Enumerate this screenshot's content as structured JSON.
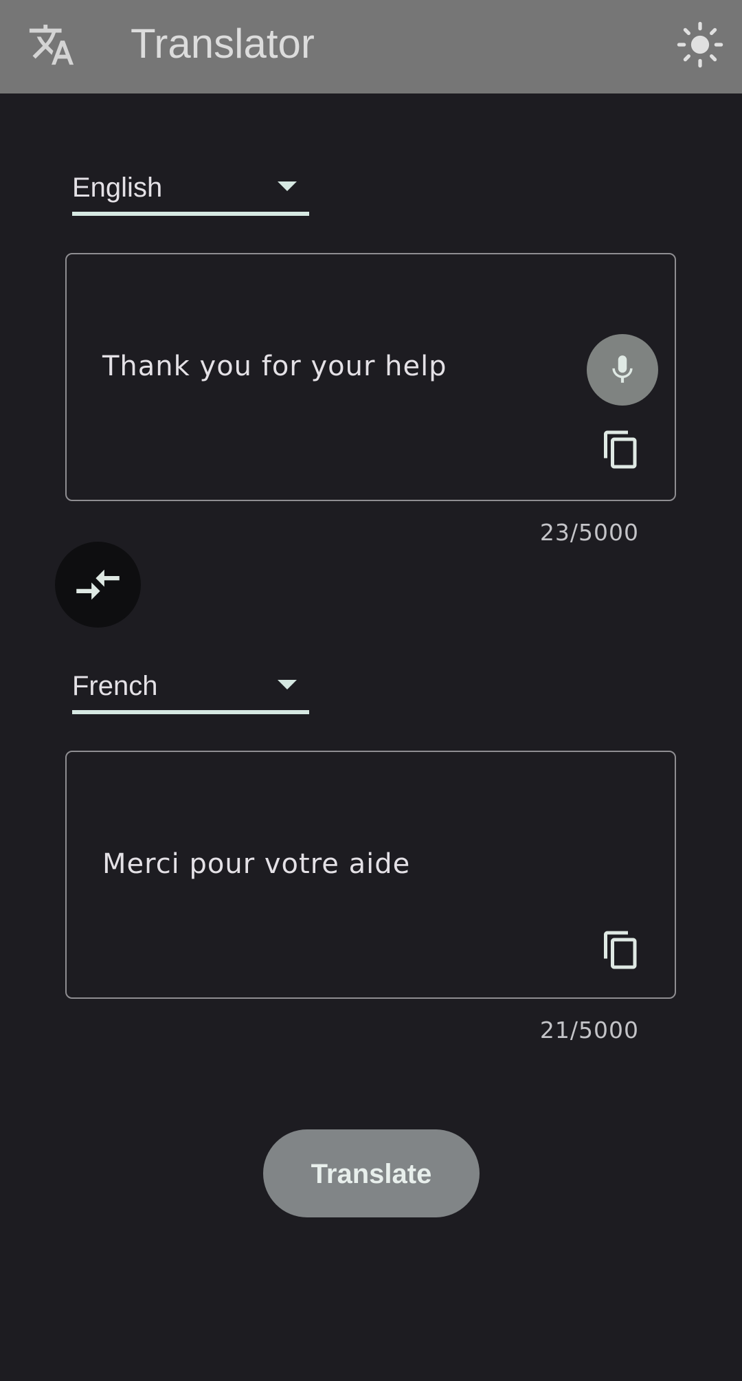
{
  "app_bar": {
    "title": "Translator",
    "app_icon": "translate-icon",
    "theme_icon": "sun-icon"
  },
  "source": {
    "language": "English",
    "text": "Thank you for your help",
    "counter": "23/5000",
    "mic_icon": "microphone-icon",
    "copy_icon": "copy-icon"
  },
  "swap": {
    "icon": "swap-arrows-icon"
  },
  "target": {
    "language": "French",
    "text": "Merci pour votre aide",
    "counter": "21/5000",
    "copy_icon": "copy-icon"
  },
  "actions": {
    "translate_label": "Translate"
  },
  "colors": {
    "background": "#1d1c21",
    "app_bar": "#767676",
    "accent": "#d6e8e2",
    "button": "#818587"
  }
}
